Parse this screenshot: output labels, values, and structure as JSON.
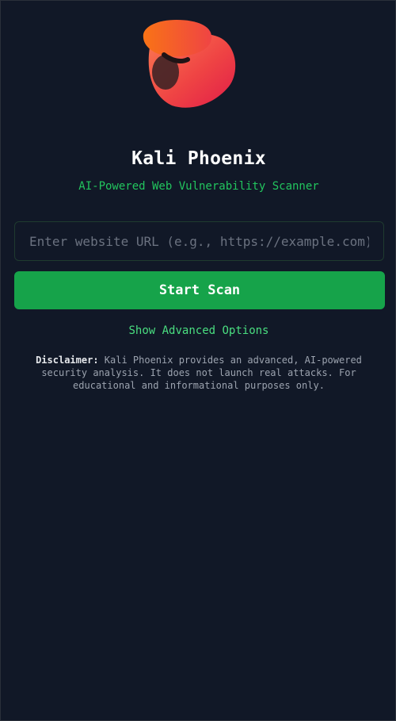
{
  "app": {
    "title": "Kali Phoenix",
    "subtitle": "AI-Powered Web Vulnerability Scanner",
    "logo_icon": "phoenix-logo-icon"
  },
  "scan_form": {
    "url_placeholder": "Enter website URL (e.g., https://example.com)",
    "url_value": "",
    "start_label": "Start Scan",
    "advanced_label": "Show Advanced Options"
  },
  "disclaimer": {
    "label": "Disclaimer:",
    "text": " Kali Phoenix provides an advanced, AI-powered security analysis. It does not launch real attacks. For educational and informational purposes only."
  },
  "colors": {
    "background": "#111827",
    "accent": "#16a34a",
    "accent_text": "#22c55e",
    "logo": "#ef4444"
  }
}
